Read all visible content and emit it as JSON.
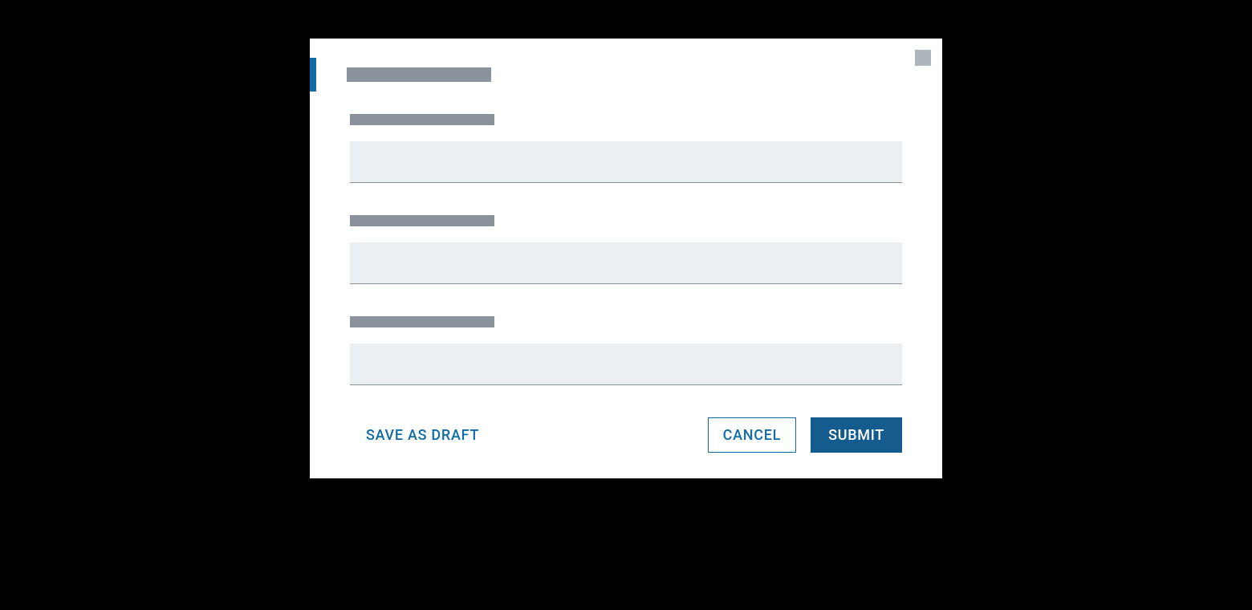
{
  "modal": {
    "close_icon_name": "close-icon",
    "title_placeholder": "",
    "fields": {
      "field1_label": "",
      "field1_value": "",
      "field2_label": "",
      "field2_value": "",
      "field3_label": "",
      "field3_value": ""
    },
    "buttons": {
      "save_draft": "SAVE AS DRAFT",
      "cancel": "CANCEL",
      "submit": "SUBMIT"
    },
    "colors": {
      "accent": "#0F6BA8",
      "primary_button": "#145C8E",
      "skeleton": "#8A929B",
      "input_bg": "#ECEFF2",
      "close_placeholder": "#AEB5BC"
    }
  }
}
